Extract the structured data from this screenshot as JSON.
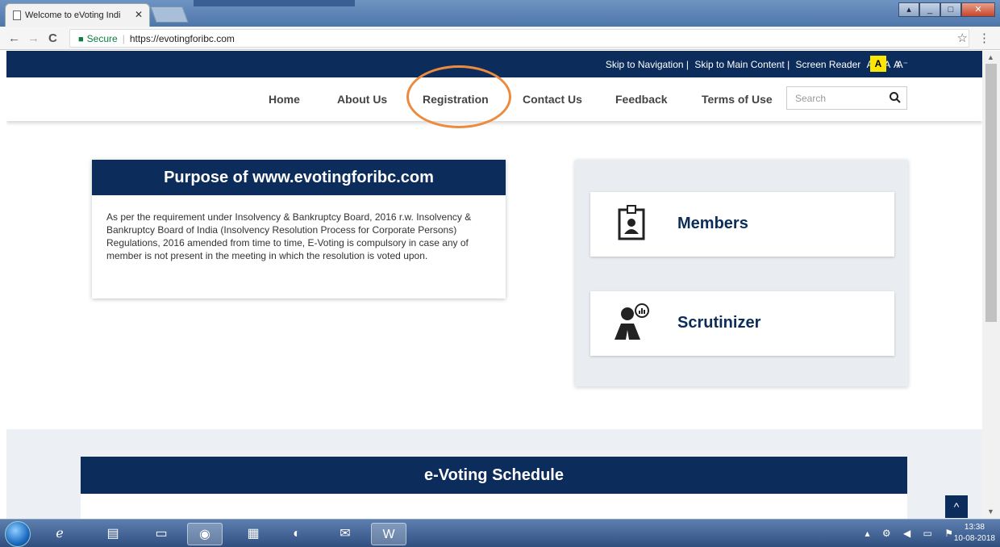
{
  "browser": {
    "tab_title": "Welcome to eVoting Indi",
    "tab_close": "✕",
    "secure_label": "Secure",
    "url": "https://evotingforibc.com",
    "back": "←",
    "forward": "→",
    "reload": "C",
    "star": "☆",
    "menu": "⋮"
  },
  "accessibility": {
    "skip_nav": "Skip to Navigation |",
    "skip_main": "Skip to Main Content |",
    "screen_reader": "Screen Reader",
    "font_increase": "A⁺",
    "font_normal": "A",
    "font_decrease": "A⁻",
    "contrast_high": "A",
    "contrast_normal": "A"
  },
  "nav": {
    "items": [
      {
        "label": "Home"
      },
      {
        "label": "About Us"
      },
      {
        "label": "Registration"
      },
      {
        "label": "Contact Us"
      },
      {
        "label": "Feedback"
      },
      {
        "label": "Terms of Use"
      }
    ],
    "search_placeholder": "Search"
  },
  "purpose": {
    "title": "Purpose of www.evotingforibc.com",
    "text": "As per the requirement under Insolvency & Bankruptcy Board, 2016 r.w. Insolvency & Bankruptcy Board of India (Insolvency Resolution Process for Corporate Persons) Regulations, 2016 amended from time to time, E-Voting is compulsory in case any of member is not present in the meeting in which the resolution is voted upon."
  },
  "roles": {
    "members": "Members",
    "scrutinizer": "Scrutinizer"
  },
  "schedule": {
    "title": "e-Voting Schedule"
  },
  "scroll_top": "^",
  "taskbar": {
    "time": "13:38",
    "date": "10-08-2018"
  },
  "colors": {
    "primary_navy": "#0c2d5b",
    "highlight_orange": "#ec8a3d",
    "contrast_yellow": "#ffe600"
  }
}
